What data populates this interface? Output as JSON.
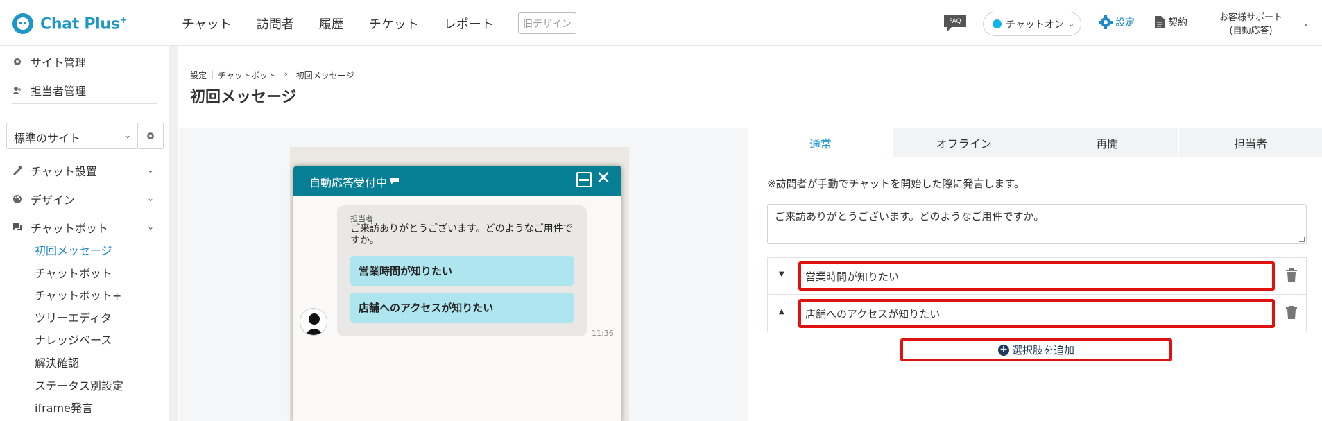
{
  "app": {
    "logo_text": "Chat Plus",
    "logo_plus": "+"
  },
  "nav": {
    "items": [
      "チャット",
      "訪問者",
      "履歴",
      "チケット",
      "レポート"
    ],
    "old_design": "旧デザイン"
  },
  "header_right": {
    "faq": "FAQ",
    "chat_toggle_label": "チャットオン",
    "settings_label": "設定",
    "contract_label": "契約",
    "user_line1": "お客様サポート",
    "user_line2": "(自動応答)"
  },
  "sidebar": {
    "site_manage": "サイト管理",
    "agent_manage": "担当者管理",
    "site_select": "標準のサイト",
    "chat_setup": "チャット設置",
    "design": "デザイン",
    "chatbot": "チャットボット",
    "sub_items": [
      "初回メッセージ",
      "チャットボット",
      "チャットボット+",
      "ツリーエディタ",
      "ナレッジベース",
      "解決確認",
      "ステータス別設定",
      "iframe発言"
    ]
  },
  "breadcrumb": {
    "settings": "設定",
    "chatbot": "チャットボット",
    "sep": "›",
    "current": "初回メッセージ"
  },
  "page_title": "初回メッセージ",
  "preview": {
    "header_title": "自動応答受付中",
    "sender": "担当者",
    "message": "ご来訪ありがとうございます。どのようなご用件ですか。",
    "choices": [
      "営業時間が知りたい",
      "店舗へのアクセスが知りたい"
    ],
    "time": "11:36"
  },
  "tabs": [
    "通常",
    "オフライン",
    "再開",
    "担当者"
  ],
  "settings": {
    "note": "※訪問者が手動でチャットを開始した際に発言します。",
    "greeting": "ご来訪ありがとうございます。どのようなご用件ですか。",
    "choice_values": [
      "営業時間が知りたい",
      "店舗へのアクセスが知りたい"
    ],
    "add_choice_label": "選択肢を追加"
  },
  "colors": {
    "brand": "#1f96c8",
    "chat_header": "#067e93",
    "choice_bg": "#aee5ef",
    "highlight": "#e0120f",
    "active_tab": "#1e9bd3"
  }
}
